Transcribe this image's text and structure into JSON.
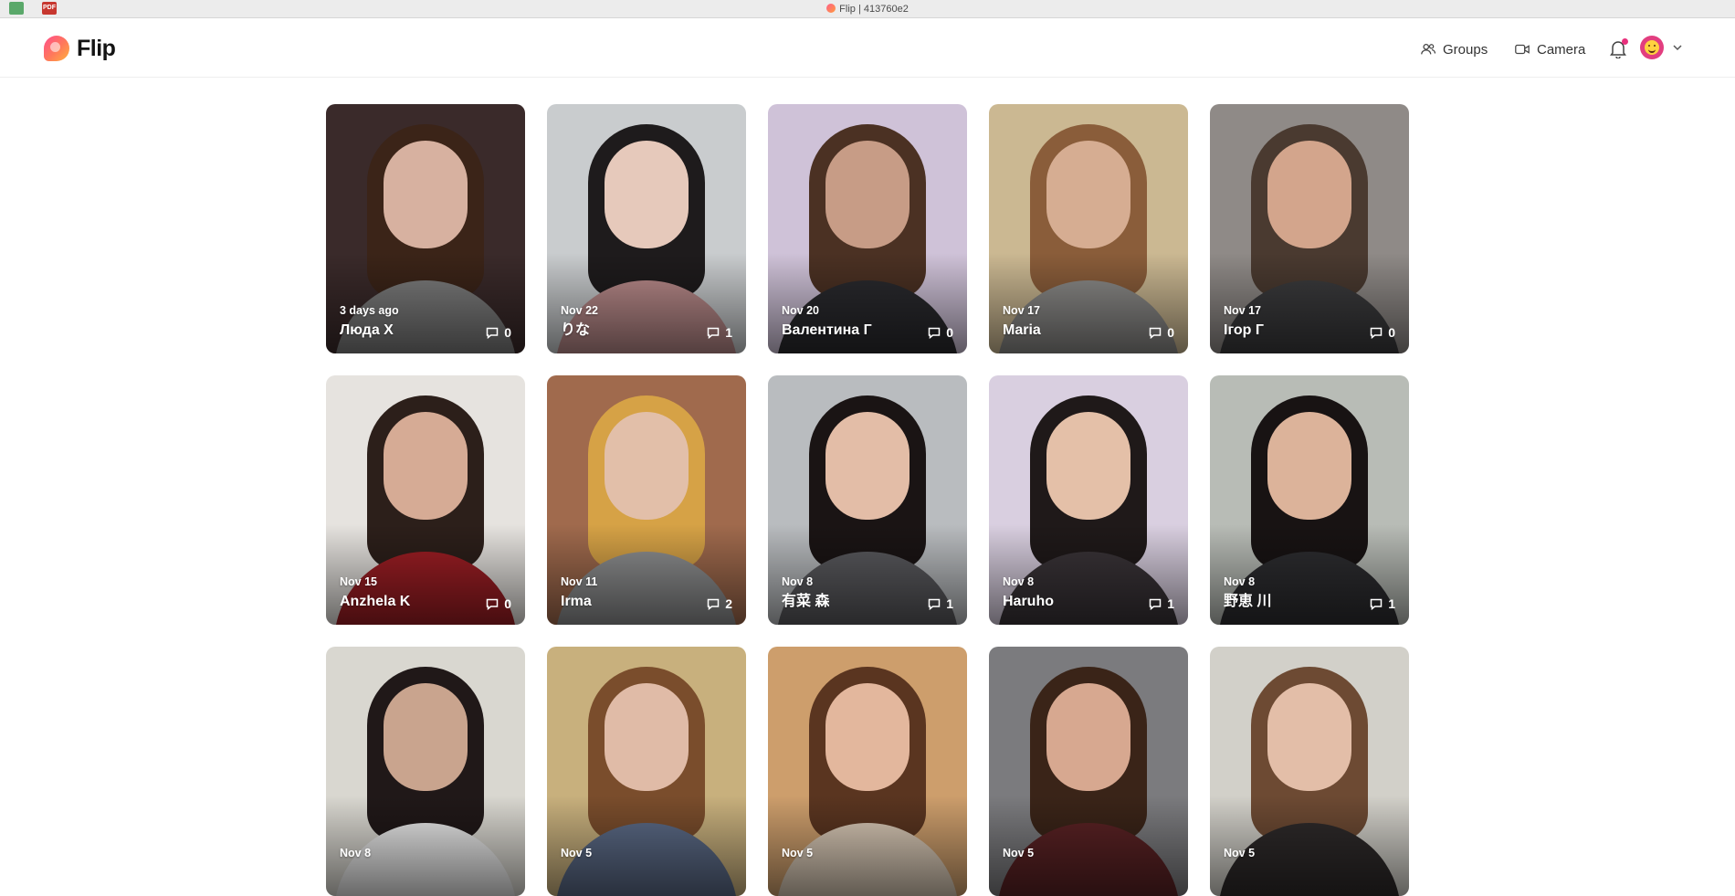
{
  "browser": {
    "title": "Flip | 413760e2",
    "tab_icons": [
      "spreadsheet-icon",
      "pdf-icon"
    ],
    "pdf_label": "PDF"
  },
  "header": {
    "logo_text": "Flip",
    "nav": {
      "groups_label": "Groups",
      "camera_label": "Camera"
    },
    "accent": "#e8307c"
  },
  "cards": [
    {
      "date": "3 days ago",
      "name": "Люда Х",
      "comments": "0",
      "bg": "#3a2a2a",
      "hair": "#3b2418",
      "skin": "#d7b1a0",
      "shirt": "#7c7c7c"
    },
    {
      "date": "Nov 22",
      "name": "りな",
      "comments": "1",
      "bg": "#c9ccce",
      "hair": "#1e1b1c",
      "skin": "#e6c9bb",
      "shirt": "#b98a8a"
    },
    {
      "date": "Nov 20",
      "name": "Валентина Г",
      "comments": "0",
      "bg": "#cfc2d8",
      "hair": "#4b3123",
      "skin": "#c79c86",
      "shirt": "#2a2a2e"
    },
    {
      "date": "Nov 17",
      "name": "Maria",
      "comments": "0",
      "bg": "#cbb892",
      "hair": "#8a5d3a",
      "skin": "#d6ad92",
      "shirt": "#8b8a88"
    },
    {
      "date": "Nov 17",
      "name": "Ігор Г",
      "comments": "0",
      "bg": "#8f8a87",
      "hair": "#4a3a30",
      "skin": "#d3a58c",
      "shirt": "#3b3b3d"
    },
    {
      "date": "Nov 15",
      "name": "Anzhela K",
      "comments": "0",
      "bg": "#e6e3df",
      "hair": "#2c1f1a",
      "skin": "#d6ab95",
      "shirt": "#9e1e24"
    },
    {
      "date": "Nov 11",
      "name": "Irma",
      "comments": "2",
      "bg": "#a06a4d",
      "hair": "#d6a246",
      "skin": "#e2bfa9",
      "shirt": "#8e8f90"
    },
    {
      "date": "Nov 8",
      "name": "有菜 森",
      "comments": "1",
      "bg": "#b9bcbf",
      "hair": "#1a1414",
      "skin": "#e3bda7",
      "shirt": "#5a5a5e"
    },
    {
      "date": "Nov 8",
      "name": "Haruho",
      "comments": "1",
      "bg": "#d9cfe0",
      "hair": "#1f1919",
      "skin": "#e4c0a8",
      "shirt": "#3a3438"
    },
    {
      "date": "Nov 8",
      "name": "野恵 川",
      "comments": "1",
      "bg": "#b8bcb6",
      "hair": "#181313",
      "skin": "#dcb39a",
      "shirt": "#2d2d30"
    },
    {
      "date": "Nov 8",
      "name": "",
      "comments": "",
      "bg": "#d9d7d0",
      "hair": "#201818",
      "skin": "#c9a48e",
      "shirt": "#e8e8e8"
    },
    {
      "date": "Nov 5",
      "name": "",
      "comments": "",
      "bg": "#c8b07d",
      "hair": "#7a4d2c",
      "skin": "#e0bba7",
      "shirt": "#5b6a86"
    },
    {
      "date": "Nov 5",
      "name": "",
      "comments": "",
      "bg": "#cd9e6c",
      "hair": "#5a3520",
      "skin": "#e3b79d",
      "shirt": "#d8c8b5"
    },
    {
      "date": "Nov 5",
      "name": "",
      "comments": "",
      "bg": "#7b7b7e",
      "hair": "#3a2418",
      "skin": "#d7a890",
      "shirt": "#5a2224"
    },
    {
      "date": "Nov 5",
      "name": "",
      "comments": "",
      "bg": "#d2d0c9",
      "hair": "#6d4a33",
      "skin": "#e3bea8",
      "shirt": "#2e2a2a"
    }
  ]
}
